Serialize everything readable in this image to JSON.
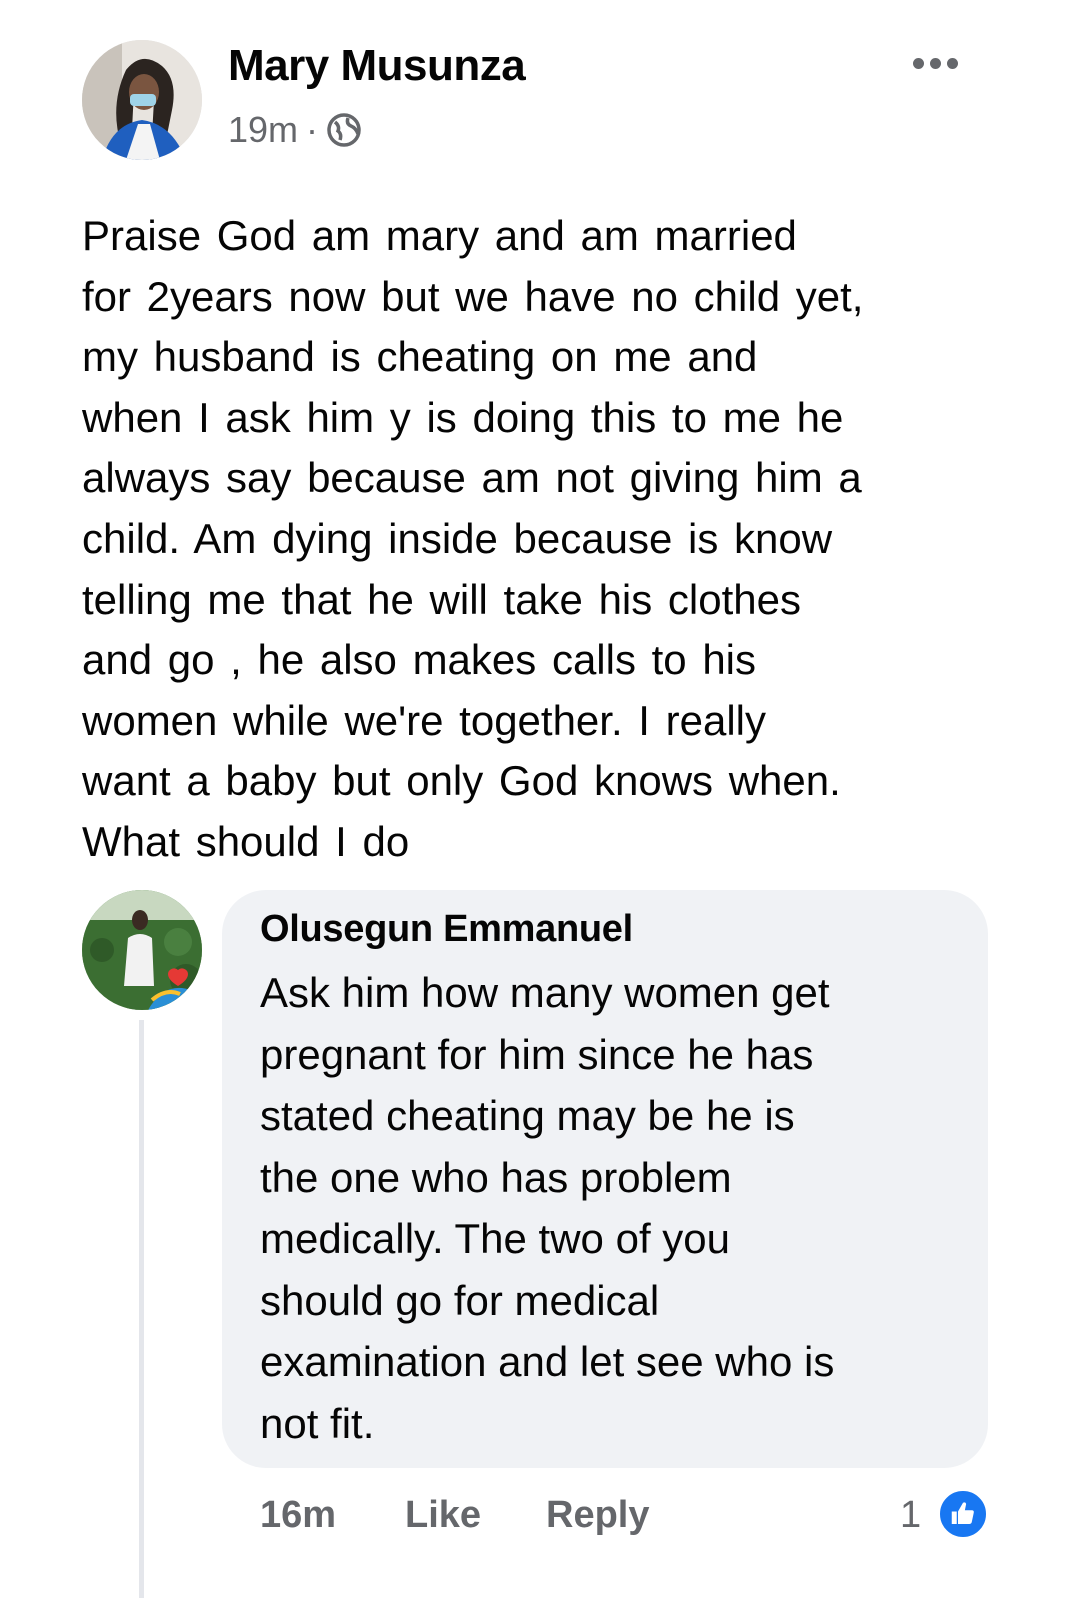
{
  "post": {
    "author": "Mary Musunza",
    "time": "19m",
    "separator": "·",
    "audience_icon": "globe-icon",
    "more_icon": "more-dots-icon",
    "lines": [
      "Praise God  am mary and  am married",
      "for  2years now  but we have no child  yet,",
      "my husband  is cheating on me  and",
      "when  I ask him y is  doing  this  to me he",
      "always  say because  am not giving  him a",
      "child.  Am dying  inside  because  is know",
      "telling me that  he will  take  his  clothes",
      "and go , he also  makes calls  to his",
      "women  while  we're  together. I really",
      "want  a baby  but only  God knows  when.",
      "What should I do"
    ]
  },
  "comment": {
    "author": "Olusegun Emmanuel",
    "lines": [
      "Ask him how many women get",
      "pregnant for him since he has",
      "stated cheating may be he is",
      "the one who has problem",
      "medically. The two of you",
      "should go for medical",
      "examination and let see who is",
      "not fit."
    ],
    "time": "16m",
    "like_label": "Like",
    "reply_label": "Reply",
    "reaction_count": "1",
    "reaction_icon": "thumbs-up-icon"
  },
  "colors": {
    "text": "#050505",
    "secondary_text": "#65676b",
    "bubble": "#f0f2f5",
    "like_blue": "#1877f2"
  }
}
